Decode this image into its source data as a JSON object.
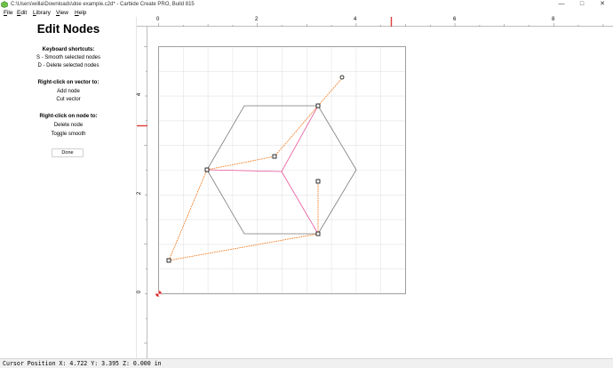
{
  "window": {
    "title": "C:\\Users\\willa\\Downloads\\doe example.c2d* - Carbide Create PRO, Build 815",
    "minimize_glyph": "—",
    "maximize_glyph": "□",
    "close_glyph": "✕"
  },
  "menu": {
    "items": [
      "File",
      "Edit",
      "Library",
      "View",
      "Help"
    ],
    "underline_letters": [
      "F",
      "E",
      "L",
      "V",
      "H"
    ]
  },
  "panel": {
    "title": "Edit Nodes",
    "shortcuts_heading": "Keyboard shortcuts:",
    "shortcut_smooth": "S - Smooth selected nodes",
    "shortcut_delete": "D - Delete selected nodes",
    "vector_heading": "Right-click on vector to:",
    "vector_add": "Add node",
    "vector_cut": "Cut vector",
    "node_heading": "Right-click on node to:",
    "node_delete": "Delete node",
    "node_toggle": "Toggle smooth",
    "done_label": "Done"
  },
  "rulers": {
    "top_labels": [
      "0",
      "2",
      "4",
      "6",
      "8"
    ],
    "left_labels": [
      "4",
      "2",
      "0"
    ],
    "top_marker_value": 4.722,
    "left_marker_value": 3.395
  },
  "status": {
    "text": "Cursor Position X: 4.722 Y: 3.395 Z: 0.000 in"
  },
  "colors": {
    "grid": "#e3e3e3",
    "stock_border": "#9a9a9a",
    "hexagon": "#7a7a7a",
    "selected_path": "#e8559a",
    "handle_line": "#f07a1e",
    "marker": "#e03a3a",
    "origin": "#d8282a"
  }
}
